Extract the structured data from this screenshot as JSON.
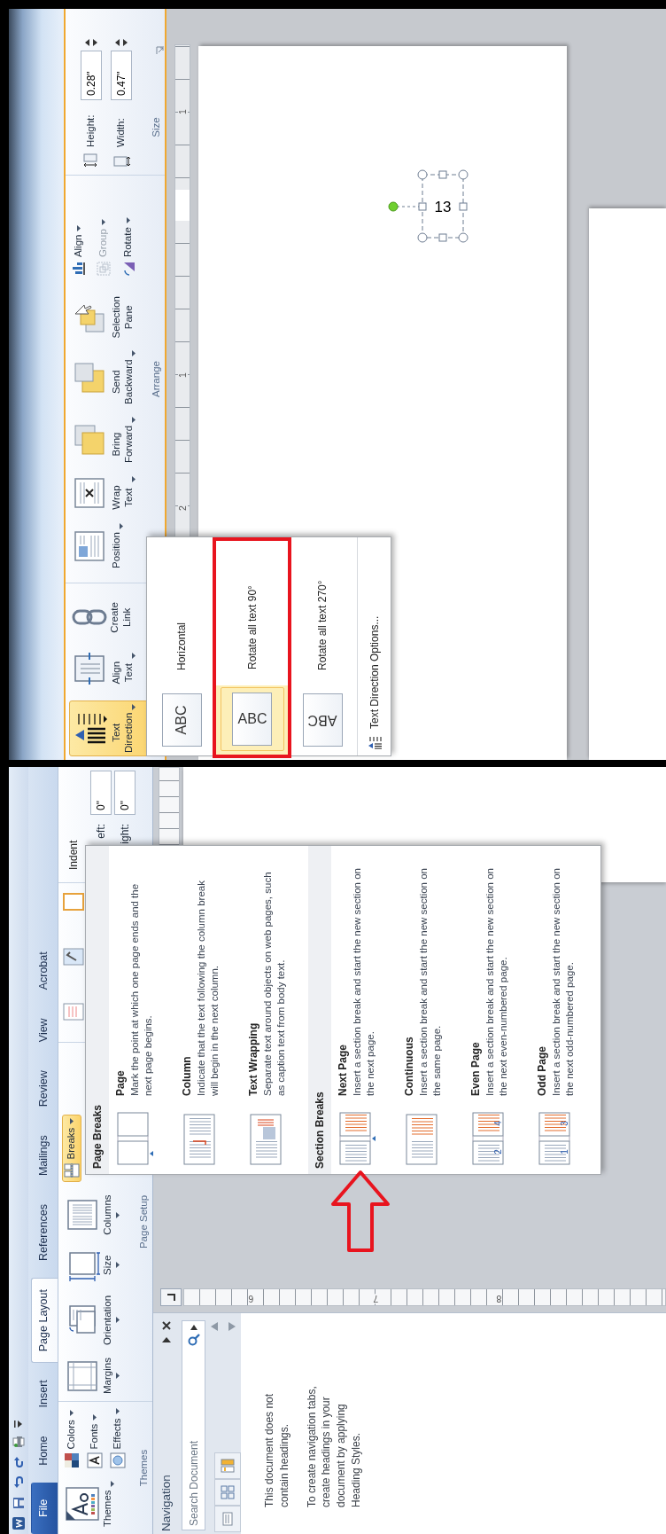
{
  "breaks_screenshot": {
    "tabs": [
      {
        "label": "File",
        "kind": "file",
        "selected": false
      },
      {
        "label": "Home",
        "kind": "tab",
        "selected": false
      },
      {
        "label": "Insert",
        "kind": "tab",
        "selected": false
      },
      {
        "label": "Page Layout",
        "kind": "tab",
        "selected": true
      },
      {
        "label": "References",
        "kind": "tab",
        "selected": false
      },
      {
        "label": "Mailings",
        "kind": "tab",
        "selected": false
      },
      {
        "label": "Review",
        "kind": "tab",
        "selected": false
      },
      {
        "label": "View",
        "kind": "tab",
        "selected": false
      },
      {
        "label": "Acrobat",
        "kind": "tab",
        "selected": false
      }
    ],
    "themes_group": {
      "label": "Themes",
      "themes_button": {
        "label": "Themes"
      },
      "items": [
        {
          "label": "Colors",
          "kind": "colors"
        },
        {
          "label": "Fonts",
          "kind": "fonts"
        },
        {
          "label": "Effects",
          "kind": "effects"
        }
      ]
    },
    "page_setup_group": {
      "label": "Page Setup",
      "buttons": [
        {
          "label": "Margins",
          "kind": "margins"
        },
        {
          "label": "Orientation",
          "kind": "orientation"
        },
        {
          "label": "Size",
          "kind": "size"
        },
        {
          "label": "Columns",
          "kind": "columns"
        }
      ],
      "breaks_button": {
        "label": "Breaks",
        "pressed": true
      }
    },
    "indent_group": {
      "label": "Indent",
      "fields": [
        {
          "label": "eft:",
          "value": "0\""
        },
        {
          "label": "ight:",
          "value": "0\""
        }
      ]
    },
    "navigation_pane": {
      "title": "Navigation",
      "search": {
        "placeholder": "Search Document"
      },
      "messages": [
        "This document does not contain headings.",
        "To create navigation tabs, create headings in your document by applying Heading Styles."
      ]
    },
    "vertical_ruler": {
      "labels": [
        "6",
        "7",
        "8"
      ]
    },
    "breaks_menu": {
      "sections": [
        {
          "heading": "Page Breaks",
          "items": [
            {
              "kind": "page",
              "title": "Page",
              "description": "Mark the point at which one page ends and the next page begins."
            },
            {
              "kind": "column",
              "title": "Column",
              "description": "Indicate that the text following the column break will begin in the next column."
            },
            {
              "kind": "text_wrapping",
              "title": "Text Wrapping",
              "description": "Separate text around objects on web pages, such as caption text from body text."
            }
          ]
        },
        {
          "heading": "Section Breaks",
          "items": [
            {
              "kind": "next_page",
              "title": "Next Page",
              "description": "Insert a section break and start the new section on the next page."
            },
            {
              "kind": "continuous",
              "title": "Continuous",
              "description": "Insert a section break and start the new section on the same page."
            },
            {
              "kind": "even_page",
              "title": "Even Page",
              "description": "Insert a section break and start the new section on the next even-numbered page.",
              "icon_numbers": [
                "2",
                "4"
              ]
            },
            {
              "kind": "odd_page",
              "title": "Odd Page",
              "description": "Insert a section break and start the new section on the next odd-numbered page.",
              "icon_numbers": [
                "1",
                "3"
              ]
            }
          ]
        }
      ]
    }
  },
  "text_direction_screenshot": {
    "text_group": {
      "buttons": [
        {
          "label": "Text Direction",
          "kind": "text_direction",
          "dropdown": true,
          "selected": true
        },
        {
          "label": "Align Text",
          "kind": "align_text",
          "dropdown": true,
          "selected": false
        },
        {
          "label": "Create Link",
          "kind": "link",
          "dropdown": false,
          "selected": false
        }
      ]
    },
    "arrange_group": {
      "label": "Arrange",
      "buttons": [
        {
          "label": "Position",
          "kind": "position",
          "dropdown": true
        },
        {
          "label": "Wrap Text",
          "kind": "wrap",
          "dropdown": true
        },
        {
          "label": "Bring Forward",
          "kind": "bring",
          "dropdown": true
        },
        {
          "label": "Send Backward",
          "kind": "send",
          "dropdown": true
        },
        {
          "label": "Selection Pane",
          "kind": "selection",
          "dropdown": false
        }
      ],
      "small_buttons": [
        {
          "label": "Align",
          "kind": "align",
          "disabled": false
        },
        {
          "label": "Group",
          "kind": "group",
          "disabled": true
        },
        {
          "label": "Rotate",
          "kind": "rotate",
          "disabled": false
        }
      ]
    },
    "size_group": {
      "label": "Size",
      "fields": [
        {
          "label": "Height:",
          "kind": "height",
          "value": "0.28\""
        },
        {
          "label": "Width:",
          "kind": "width",
          "value": "0.47\""
        }
      ]
    },
    "ruler": {
      "labels": [
        "2",
        "1",
        "1"
      ]
    },
    "text_box": {
      "text": "13"
    },
    "text_direction_menu": {
      "items": [
        {
          "kind": "horizontal",
          "sample": "ABC",
          "label": "Horizontal",
          "selected": false
        },
        {
          "kind": "rotate90",
          "sample": "ABC",
          "label": "Rotate all text 90°",
          "selected": true
        },
        {
          "kind": "rotate270",
          "sample": "ABC",
          "label": "Rotate all text 270°",
          "selected": false
        }
      ],
      "options_label": "Text Direction Options..."
    }
  }
}
